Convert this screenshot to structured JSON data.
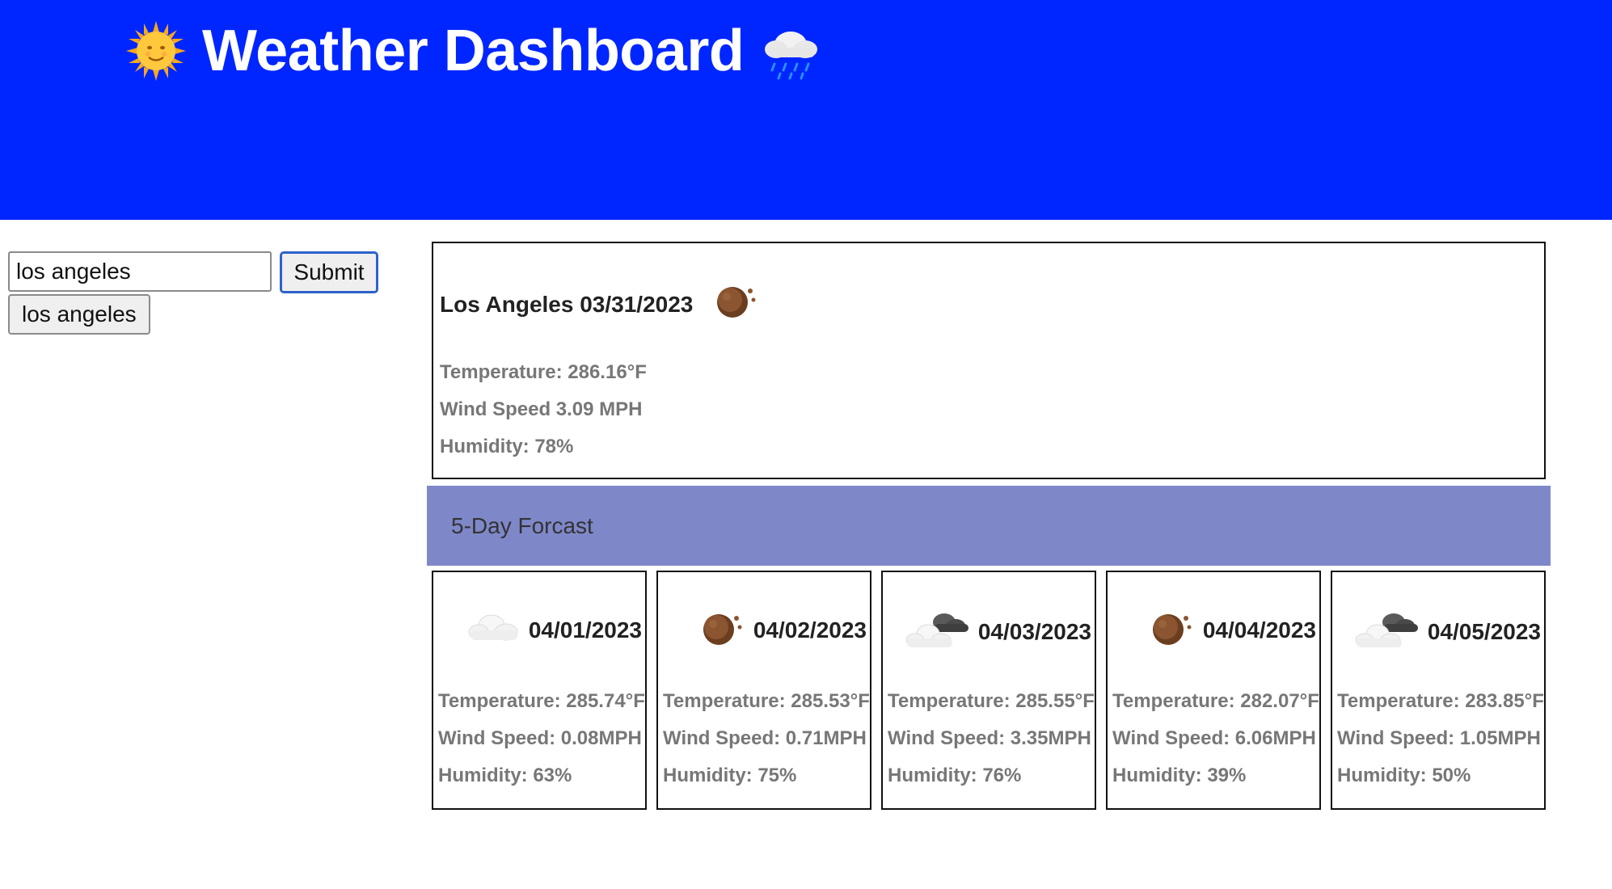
{
  "header": {
    "title": "Weather Dashboard",
    "left_icon": "sun-with-face-icon",
    "right_icon": "cloud-with-rain-icon",
    "background": "#0026ff"
  },
  "search": {
    "input_value": "los angeles",
    "submit_label": "Submit",
    "history": [
      "los angeles"
    ]
  },
  "current": {
    "title": "Los Angeles 03/31/2023",
    "icon": "moon-night-icon",
    "temperature": "Temperature: 286.16°F",
    "wind": "Wind Speed 3.09 MPH",
    "humidity": "Humidity: 78%"
  },
  "forecast": {
    "heading": "5-Day Forcast",
    "bar_color": "#7e88c9",
    "days": [
      {
        "date": "04/01/2023",
        "icon": "cloud-icon",
        "temperature": "Temperature: 285.74°F",
        "wind": "Wind Speed: 0.08MPH",
        "humidity": "Humidity: 63%"
      },
      {
        "date": "04/02/2023",
        "icon": "moon-night-icon",
        "temperature": "Temperature: 285.53°F",
        "wind": "Wind Speed: 0.71MPH",
        "humidity": "Humidity: 75%"
      },
      {
        "date": "04/03/2023",
        "icon": "dark-cloud-icon",
        "temperature": "Temperature: 285.55°F",
        "wind": "Wind Speed: 3.35MPH",
        "humidity": "Humidity: 76%"
      },
      {
        "date": "04/04/2023",
        "icon": "moon-night-icon",
        "temperature": "Temperature: 282.07°F",
        "wind": "Wind Speed: 6.06MPH",
        "humidity": "Humidity: 39%"
      },
      {
        "date": "04/05/2023",
        "icon": "dark-cloud-icon",
        "temperature": "Temperature: 283.85°F",
        "wind": "Wind Speed: 1.05MPH",
        "humidity": "Humidity: 50%"
      }
    ]
  }
}
